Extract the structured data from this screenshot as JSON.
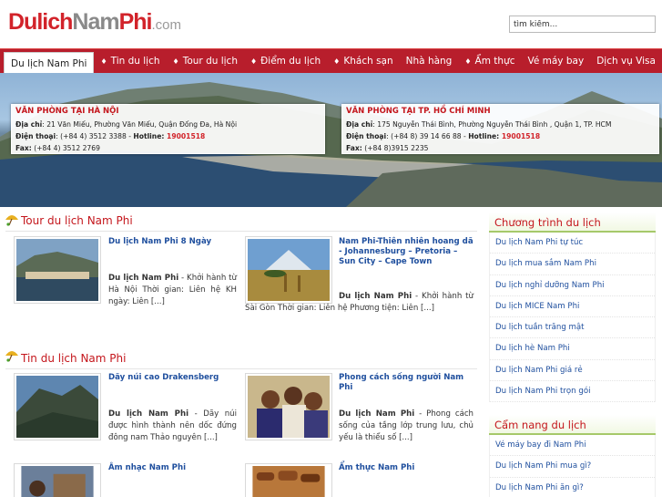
{
  "header": {
    "logo_part1": "Dulich",
    "logo_part2": "Nam",
    "logo_part3": "Phi",
    "logo_part4": ".com",
    "search_placeholder": "tìm kiếm..."
  },
  "nav": {
    "items": [
      {
        "label": "Du lịch Nam Phi",
        "active": true
      },
      {
        "label": "Tin du lịch",
        "arrow": "♦"
      },
      {
        "label": "Tour du lịch",
        "arrow": "♦"
      },
      {
        "label": "Điểm du lịch",
        "arrow": "♦"
      },
      {
        "label": "Khách sạn",
        "arrow": "♦"
      },
      {
        "label": "Nhà hàng"
      },
      {
        "label": "Ẩm thực",
        "arrow": "♦"
      },
      {
        "label": "Vé máy bay"
      },
      {
        "label": "Dịch vụ Visa"
      }
    ]
  },
  "offices": {
    "hanoi": {
      "title": "VĂN PHÒNG TẠI HÀ NỘI",
      "address_label": "Địa chỉ",
      "address": ": 21 Văn Miếu, Phường Văn Miếu, Quận Đống Đa, Hà Nội",
      "phone_label": "Điện thoại",
      "phone": ": (+84 4) 3512 3388 - ",
      "hotline_label": "Hotline: ",
      "hotline": "19001518",
      "fax_label": "Fax:",
      "fax": " (+84 4) 3512 2769"
    },
    "hcm": {
      "title": "VĂN PHÒNG TẠI TP. HỒ CHÍ MINH",
      "address_label": "Địa chỉ",
      "address": ": 175 Nguyễn Thái Bình, Phường Nguyễn Thái Bình , Quận 1, TP. HCM",
      "phone_label": "Điện thoại",
      "phone": ": (+84 8) 39 14 66 88 - ",
      "hotline_label": "Hotline: ",
      "hotline": "19001518",
      "fax_label": "Fax:",
      "fax": " (+84 8)3915 2235"
    }
  },
  "tours": {
    "title": "Tour du lịch Nam Phi",
    "items": [
      {
        "title": "Du lịch Nam Phi 8 Ngày",
        "lead": "Du lịch Nam Phi",
        "desc": " - Khởi hành từ Hà Nội Thời gian: Liên hệ KH ngày: Liên [...]"
      },
      {
        "title": "Nam Phi-Thiên nhiên hoang dã - Johannesburg – Pretoria – Sun City – Cape Town",
        "lead": "Du lịch Nam Phi",
        "desc": " - Khởi hành từ Sài Gòn Thời gian: Liên hệ Phương tiện: Liên [...]"
      }
    ]
  },
  "news": {
    "title": "Tin du lịch Nam Phi",
    "items": [
      {
        "title": "Dãy núi cao Drakensberg",
        "lead": "Du lịch Nam Phi",
        "desc": " - Dãy núi được hình thành nên dốc đứng đông nam Thảo nguyên [...]"
      },
      {
        "title": "Phong cách sống người Nam Phi",
        "lead": "Du lịch Nam Phi",
        "desc": " - Phong cách sống của tầng lớp trung lưu, chủ yếu là thiểu số [...]"
      },
      {
        "title": "Âm nhạc Nam Phi"
      },
      {
        "title": "Ẩm thực Nam Phi"
      }
    ]
  },
  "sidebar": {
    "programs_title": "Chương trình du lịch",
    "programs": [
      "Du lịch Nam Phi tự túc",
      "Du lịch mua sắm Nam Phi",
      "Du lịch nghỉ dưỡng Nam Phi",
      "Du lịch MICE Nam Phi",
      "Du lịch tuần trăng mật",
      "Du lịch hè Nam Phi",
      "Du lịch Nam Phi giá rẻ",
      "Du lịch Nam Phi trọn gói"
    ],
    "guide_title": "Cẩm nang du lịch",
    "guide": [
      "Vé máy bay đi Nam Phi",
      "Du lịch Nam Phi mua gì?",
      "Du lịch Nam Phi ăn gì?"
    ]
  },
  "colors": {
    "brand_red": "#b81e2c",
    "link_blue": "#1f4f9e",
    "accent_green": "#a6c96a"
  }
}
